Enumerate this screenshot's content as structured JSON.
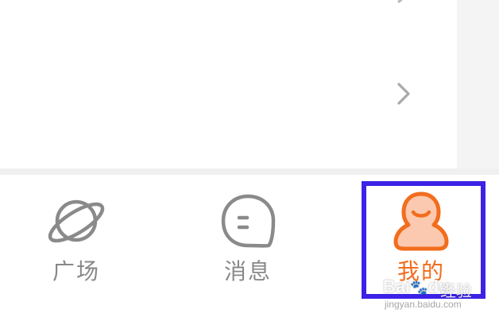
{
  "tab_bar": {
    "tabs": [
      {
        "label": "广场",
        "icon": "planet-icon",
        "active": false
      },
      {
        "label": "消息",
        "icon": "chat-bubble-icon",
        "active": false
      },
      {
        "label": "我的",
        "icon": "profile-icon",
        "active": true
      }
    ]
  },
  "watermark": {
    "brand": "Bai",
    "brand_suffix": "du",
    "product": "经验",
    "url": "jingyan.baidu.com"
  },
  "colors": {
    "accent": "#f26d1d",
    "inactive": "#888888",
    "highlight": "#3b22e6",
    "gutter": "#f4f4f4"
  }
}
